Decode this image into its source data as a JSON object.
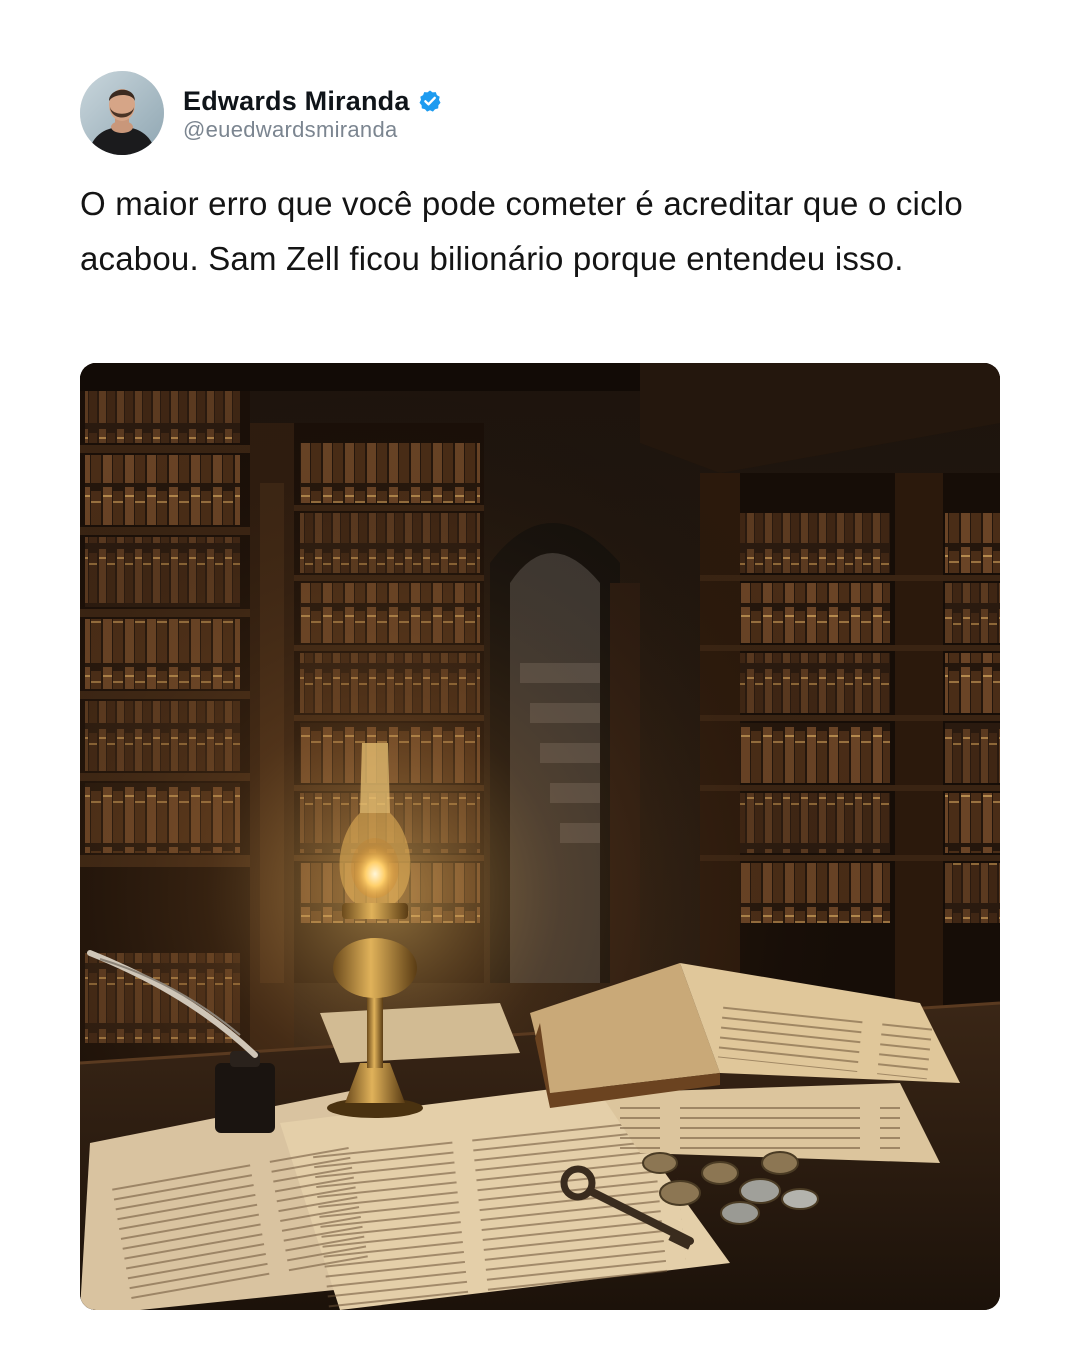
{
  "author": {
    "display_name": "Edwards Miranda",
    "handle": "@euedwardsmiranda",
    "verified": true,
    "avatar_icon": "profile-photo"
  },
  "tweet": {
    "text": "O maior erro que você pode cometer é acreditar que o ciclo acabou. Sam Zell ficou bilionário porque entendeu isso."
  },
  "media": {
    "type": "image",
    "subject_icon": "library-lamp-photo"
  },
  "colors": {
    "verified_blue": "#1d9bf0",
    "text": "#141414",
    "handle": "#7b8590"
  }
}
